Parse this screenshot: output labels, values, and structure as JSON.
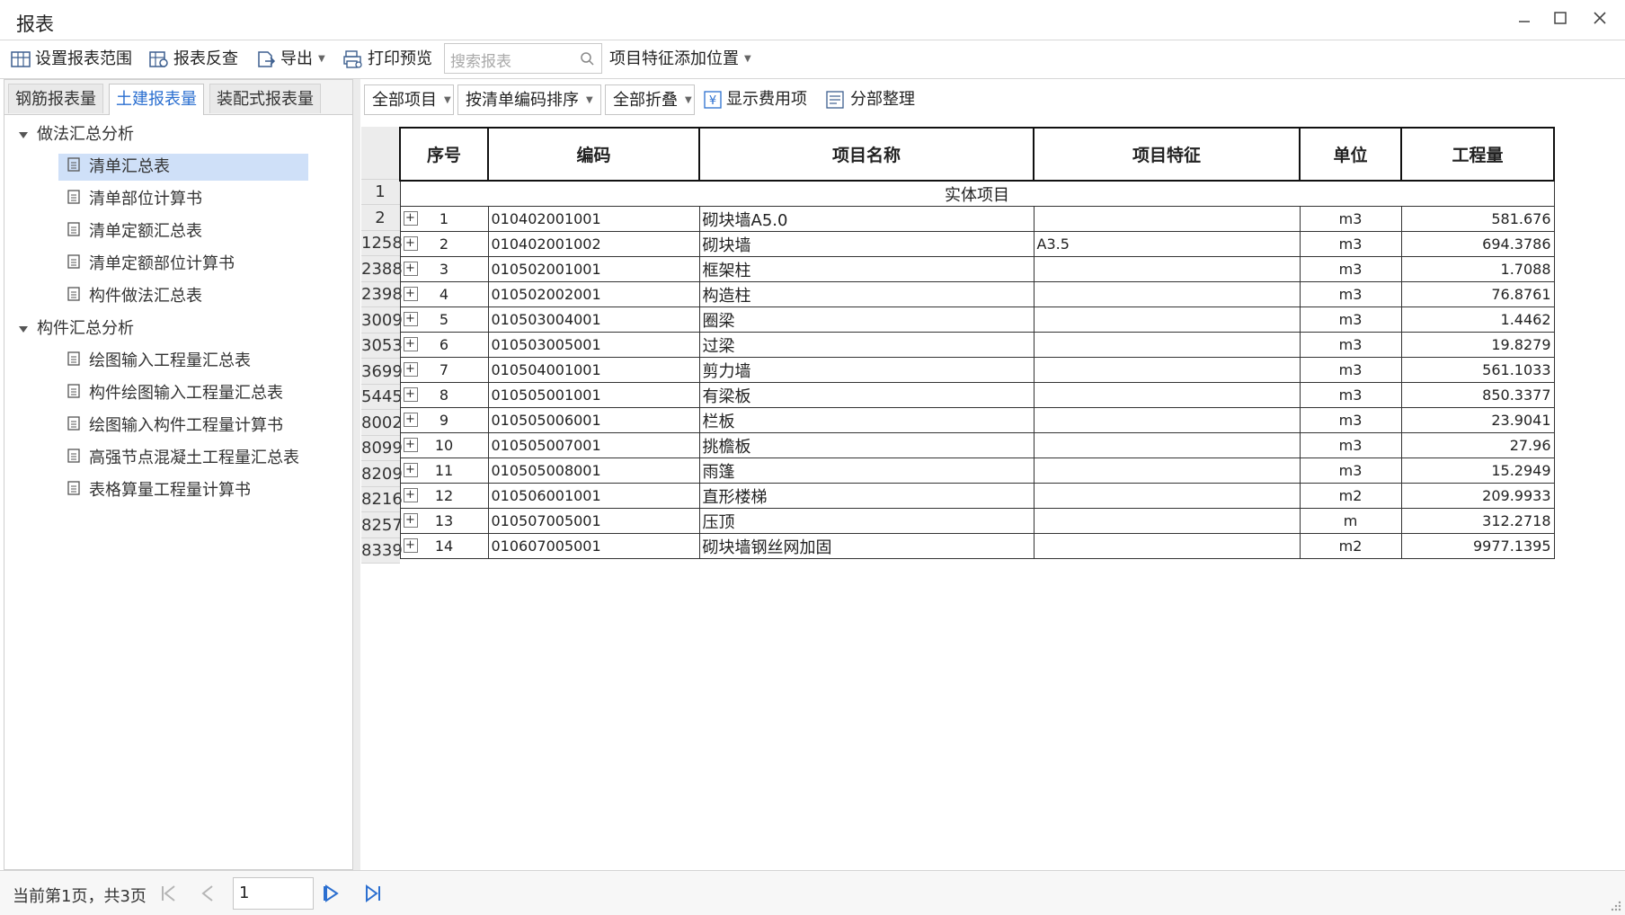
{
  "window": {
    "title": "报表"
  },
  "toolbar": {
    "set_range": "设置报表范围",
    "report_check": "报表反查",
    "export": "导出",
    "print_preview": "打印预览",
    "search_placeholder": "搜索报表",
    "feature_position": "项目特征添加位置"
  },
  "tabs": [
    "钢筋报表量",
    "土建报表量",
    "装配式报表量"
  ],
  "tree": {
    "group1": "做法汇总分析",
    "group1_items": [
      "清单汇总表",
      "清单部位计算书",
      "清单定额汇总表",
      "清单定额部位计算书",
      "构件做法汇总表"
    ],
    "group2": "构件汇总分析",
    "group2_items": [
      "绘图输入工程量汇总表",
      "构件绘图输入工程量汇总表",
      "绘图输入构件工程量计算书",
      "高强节点混凝土工程量汇总表",
      "表格算量工程量计算书"
    ]
  },
  "subtoolbar": {
    "all_items": "全部项目",
    "sort": "按清单编码排序",
    "collapse": "全部折叠",
    "show_fee": "显示费用项",
    "sub_arrange": "分部整理"
  },
  "table": {
    "headers": [
      "序号",
      "编码",
      "项目名称",
      "项目特征",
      "单位",
      "工程量"
    ],
    "group_label": "实体项目",
    "row_numbers": [
      "1",
      "2",
      "1258",
      "2388",
      "2398",
      "3009",
      "3053",
      "3699",
      "5445",
      "8002",
      "8099",
      "8209",
      "8216",
      "8257",
      "8339"
    ],
    "rows": [
      {
        "seq": "1",
        "code": "010402001001",
        "name": "砌块墙A5.0",
        "feature": "",
        "unit": "m3",
        "qty": "581.676"
      },
      {
        "seq": "2",
        "code": "010402001002",
        "name": "砌块墙",
        "feature": "A3.5",
        "unit": "m3",
        "qty": "694.3786"
      },
      {
        "seq": "3",
        "code": "010502001001",
        "name": "框架柱",
        "feature": "",
        "unit": "m3",
        "qty": "1.7088"
      },
      {
        "seq": "4",
        "code": "010502002001",
        "name": "构造柱",
        "feature": "",
        "unit": "m3",
        "qty": "76.8761"
      },
      {
        "seq": "5",
        "code": "010503004001",
        "name": "圈梁",
        "feature": "",
        "unit": "m3",
        "qty": "1.4462"
      },
      {
        "seq": "6",
        "code": "010503005001",
        "name": "过梁",
        "feature": "",
        "unit": "m3",
        "qty": "19.8279"
      },
      {
        "seq": "7",
        "code": "010504001001",
        "name": "剪力墙",
        "feature": "",
        "unit": "m3",
        "qty": "561.1033"
      },
      {
        "seq": "8",
        "code": "010505001001",
        "name": "有梁板",
        "feature": "",
        "unit": "m3",
        "qty": "850.3377"
      },
      {
        "seq": "9",
        "code": "010505006001",
        "name": "栏板",
        "feature": "",
        "unit": "m3",
        "qty": "23.9041"
      },
      {
        "seq": "10",
        "code": "010505007001",
        "name": "挑檐板",
        "feature": "",
        "unit": "m3",
        "qty": "27.96"
      },
      {
        "seq": "11",
        "code": "010505008001",
        "name": "雨篷",
        "feature": "",
        "unit": "m3",
        "qty": "15.2949"
      },
      {
        "seq": "12",
        "code": "010506001001",
        "name": "直形楼梯",
        "feature": "",
        "unit": "m2",
        "qty": "209.9933"
      },
      {
        "seq": "13",
        "code": "010507005001",
        "name": "压顶",
        "feature": "",
        "unit": "m",
        "qty": "312.2718"
      },
      {
        "seq": "14",
        "code": "010607005001",
        "name": "砌块墙钢丝网加固",
        "feature": "",
        "unit": "m2",
        "qty": "9977.1395"
      }
    ]
  },
  "status": {
    "page_info": "当前第1页，共3页",
    "page_value": "1"
  },
  "colors": {
    "accent": "#2b6fd0",
    "selected_bg": "#cfe0f8"
  }
}
